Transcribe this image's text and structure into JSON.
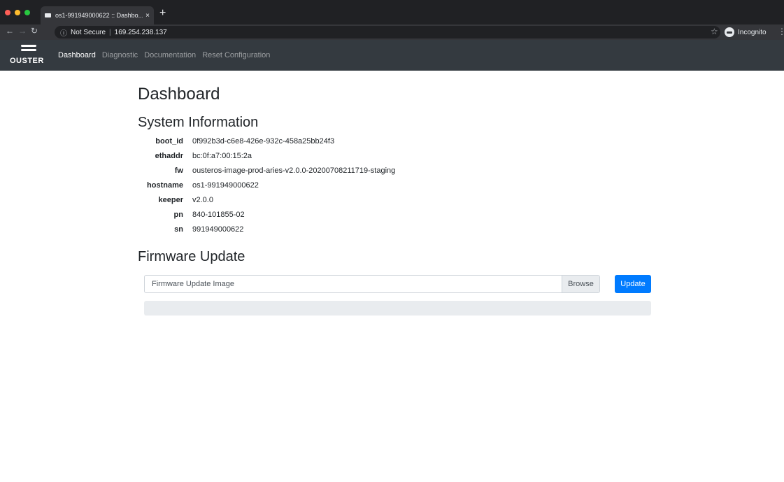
{
  "browser": {
    "tab_title": "os1-991949000622 :: Dashbo...",
    "tab_close": "×",
    "new_tab": "+",
    "security_label": "Not Secure",
    "url": "169.254.238.137",
    "incognito_label": "Incognito",
    "traffic_colors": [
      "#ff5f57",
      "#febc2e",
      "#28c840"
    ]
  },
  "navbar": {
    "brand": "OUSTER",
    "links": [
      {
        "label": "Dashboard",
        "active": true
      },
      {
        "label": "Diagnostic",
        "active": false
      },
      {
        "label": "Documentation",
        "active": false
      },
      {
        "label": "Reset Configuration",
        "active": false
      }
    ]
  },
  "page": {
    "title": "Dashboard",
    "system_info": {
      "heading": "System Information",
      "rows": [
        {
          "key": "boot_id",
          "value": "0f992b3d-c6e8-426e-932c-458a25bb24f3"
        },
        {
          "key": "ethaddr",
          "value": "bc:0f:a7:00:15:2a"
        },
        {
          "key": "fw",
          "value": "ousteros-image-prod-aries-v2.0.0-20200708211719-staging"
        },
        {
          "key": "hostname",
          "value": "os1-991949000622"
        },
        {
          "key": "keeper",
          "value": "v2.0.0"
        },
        {
          "key": "pn",
          "value": "840-101855-02"
        },
        {
          "key": "sn",
          "value": "991949000622"
        }
      ]
    },
    "firmware": {
      "heading": "Firmware Update",
      "file_placeholder": "Firmware Update Image",
      "browse_label": "Browse",
      "update_label": "Update",
      "progress_fraction": 0
    }
  }
}
